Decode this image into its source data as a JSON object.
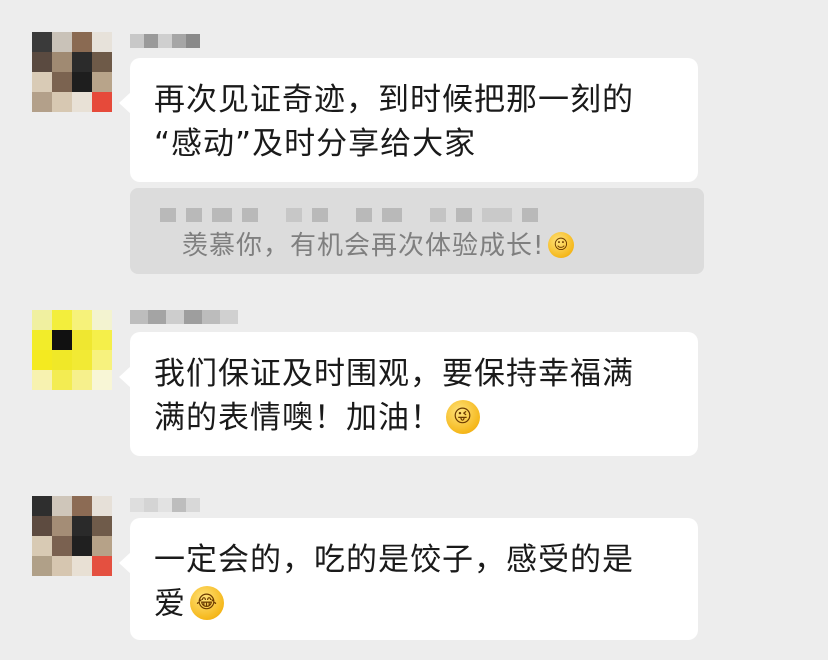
{
  "messages": [
    {
      "text": "再次见证奇迹，到时候把那一刻的“感动”及时分享给大家",
      "line1": "再次见证奇迹，到时候把那一刻的",
      "line2": "“感动”及时分享给大家"
    },
    {
      "line1": "我们保证及时围观，要保持幸福满",
      "line2": "满的表情噢！加油！",
      "emoji": "winking-tongue-emoji"
    },
    {
      "line1": "一定会的，吃的是饺子，感受的是",
      "line2": "爱",
      "emoji": "laughing-crying-emoji"
    }
  ],
  "quote": {
    "text": "羡慕你，有机会再次体验成长!",
    "emoji": "grinning-emoji"
  },
  "colors": {
    "background": "#ededed",
    "bubble": "#ffffff",
    "quote_bg": "#dcdcdc",
    "text": "#1a1a1a",
    "quote_text": "#7f7f7f"
  }
}
